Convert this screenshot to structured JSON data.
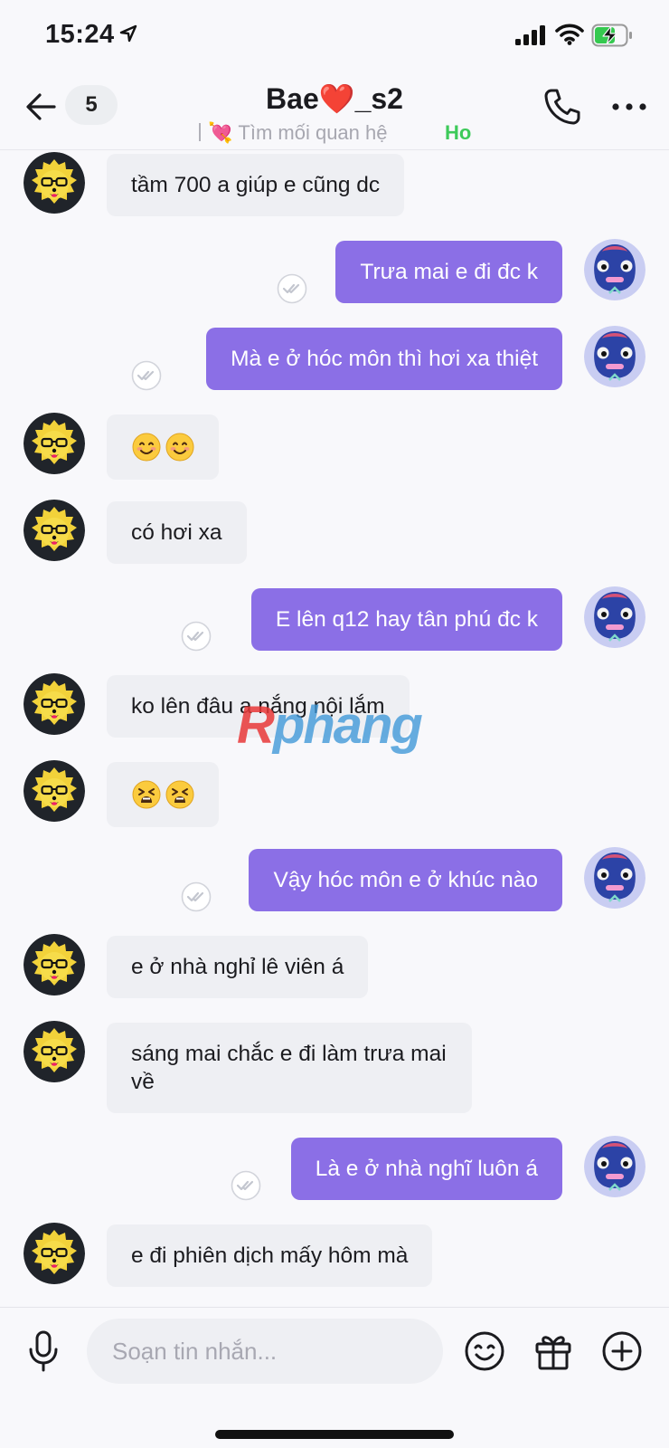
{
  "status_bar": {
    "time": "15:24"
  },
  "header": {
    "unread_count": "5",
    "contact_name_prefix": "Bae",
    "contact_name_heart": "❤️",
    "contact_name_suffix": "_s2",
    "status_heart": "💘",
    "status_text": "Tìm mối quan hệ",
    "online_text": "Ho"
  },
  "messages": [
    {
      "dir": "in",
      "text": "tầm 700 a giúp e cũng dc"
    },
    {
      "dir": "out",
      "text": "Trưa mai e đi đc k"
    },
    {
      "dir": "out",
      "text": "Mà e ở hóc môn thì hơi xa thiệt"
    },
    {
      "dir": "in",
      "emoji": [
        "smiling-face",
        "smiling-face"
      ]
    },
    {
      "dir": "in",
      "text": "có hơi xa"
    },
    {
      "dir": "out",
      "text": "E lên q12 hay tân phú đc k"
    },
    {
      "dir": "in",
      "text": "ko lên đâu a nắng nội lắm"
    },
    {
      "dir": "in",
      "emoji": [
        "tired-face",
        "tired-face"
      ]
    },
    {
      "dir": "out",
      "text": "Vậy hóc môn e ở khúc nào"
    },
    {
      "dir": "in",
      "text": "e ở nhà nghỉ lê viên á"
    },
    {
      "dir": "in",
      "text": "sáng mai chắc e đi làm trưa mai về"
    },
    {
      "dir": "out",
      "text": "Là e ở nhà nghĩ luôn á"
    },
    {
      "dir": "in",
      "text": "e đi phiên dịch mấy hôm mà"
    }
  ],
  "watermark": {
    "first": "R",
    "rest": "phang"
  },
  "composer": {
    "placeholder": "Soạn tin nhắn..."
  },
  "colors": {
    "outgoing_bubble": "#8b6fe6",
    "incoming_bubble": "#eeeff3",
    "online": "#3dca5a"
  }
}
